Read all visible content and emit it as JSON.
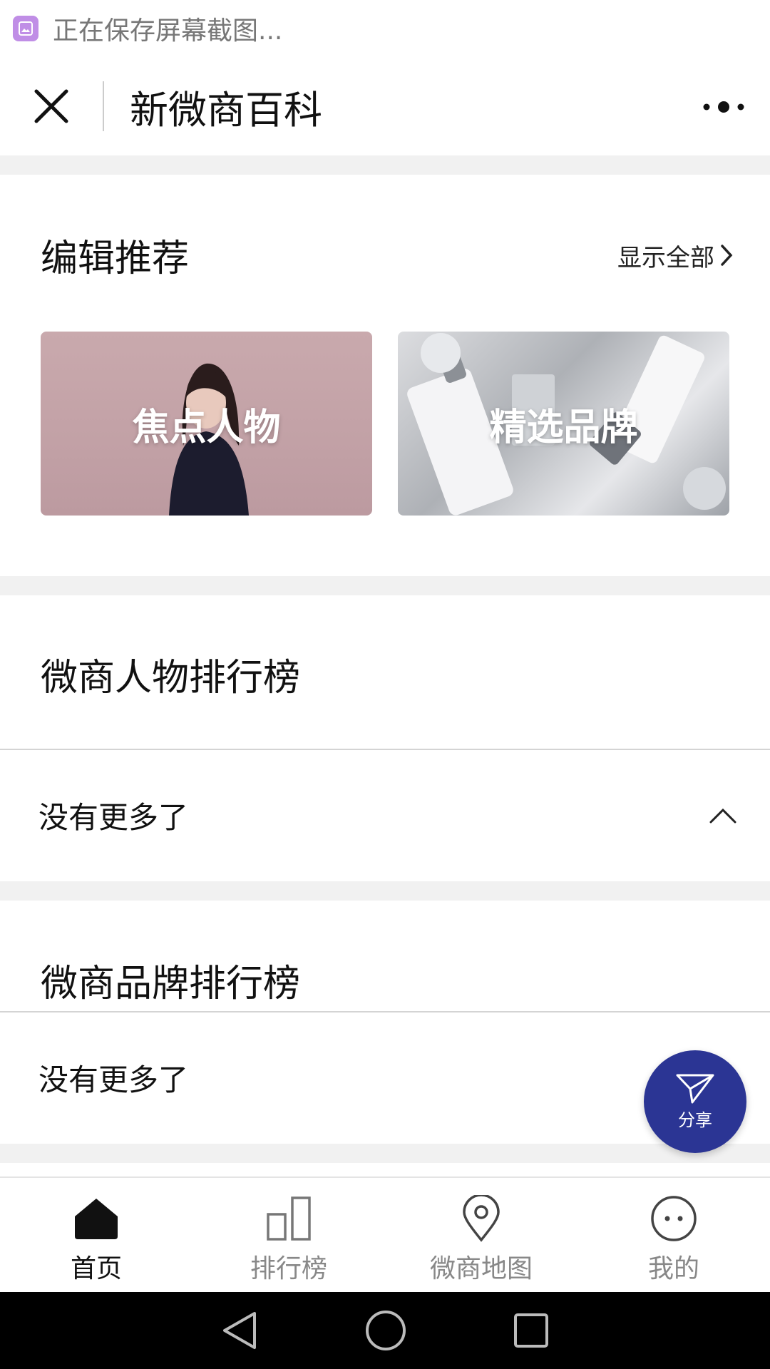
{
  "status_bar": {
    "text": "正在保存屏幕截图..."
  },
  "header": {
    "title": "新微商百科"
  },
  "editor_section": {
    "title": "编辑推荐",
    "show_all": "显示全部",
    "cards": [
      {
        "label": "焦点人物"
      },
      {
        "label": "精选品牌"
      }
    ]
  },
  "people_rank": {
    "title": "微商人物排行榜",
    "no_more": "没有更多了"
  },
  "brand_rank": {
    "title": "微商品牌排行榜",
    "no_more": "没有更多了"
  },
  "share": {
    "label": "分享"
  },
  "tabs": [
    {
      "label": "首页",
      "icon": "home-icon"
    },
    {
      "label": "排行榜",
      "icon": "ranking-icon"
    },
    {
      "label": "微商地图",
      "icon": "location-pin-icon"
    },
    {
      "label": "我的",
      "icon": "face-icon"
    }
  ],
  "colors": {
    "accent": "#2b3594",
    "separator": "#f1f1f1"
  }
}
